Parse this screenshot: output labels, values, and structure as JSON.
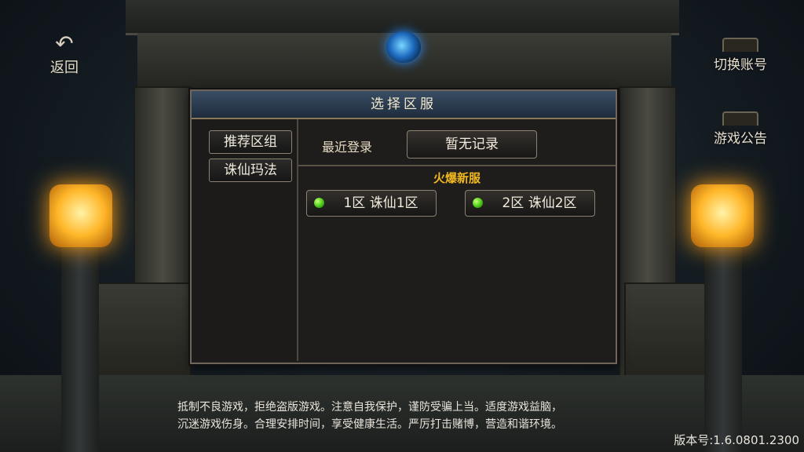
{
  "top": {
    "back_label": "返回",
    "switch_account_label": "切换账号",
    "game_notice_label": "游戏公告"
  },
  "dialog": {
    "title": "选择区服",
    "tabs": [
      {
        "label": "推荐区组"
      },
      {
        "label": "诛仙玛法"
      }
    ],
    "recent_label": "最近登录",
    "recent_value": "暂无记录",
    "hot_title": "火爆新服",
    "servers": [
      {
        "name": "1区 诛仙1区",
        "status_color": "#4fce1a"
      },
      {
        "name": "2区 诛仙2区",
        "status_color": "#4fce1a"
      }
    ]
  },
  "footer": {
    "notice_line1": "抵制不良游戏，拒绝盗版游戏。注意自我保护，谨防受骗上当。适度游戏益脑，",
    "notice_line2": "沉迷游戏伤身。合理安排时间，享受健康生活。严厉打击赌博，营造和谐环境。",
    "version": "版本号:1.6.0801.2300"
  },
  "icons": {
    "back": "back-arrow-icon",
    "gem": "blue-gem-icon",
    "lamp": "lantern-icon",
    "status": "green-dot-icon"
  }
}
